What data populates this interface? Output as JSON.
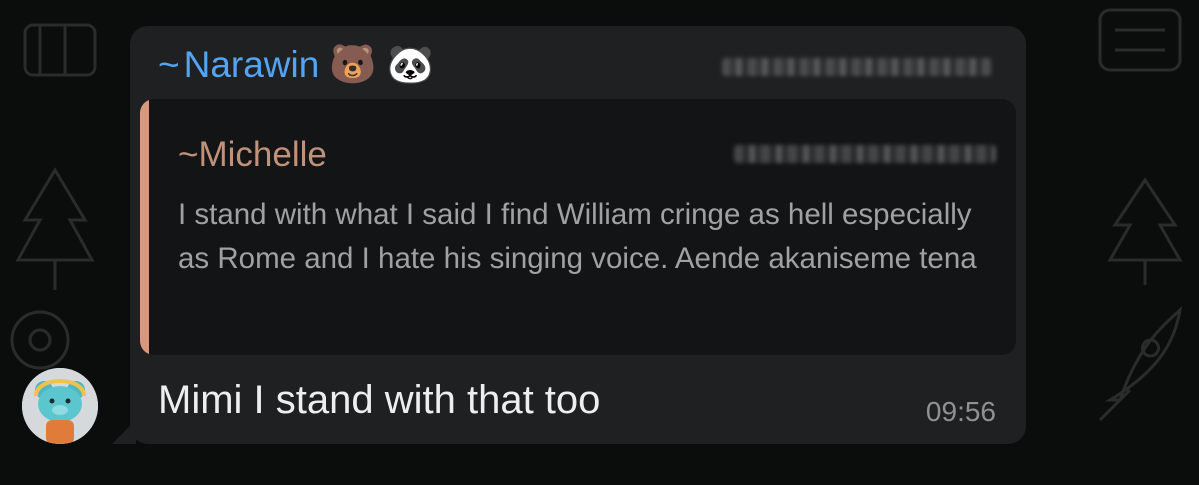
{
  "message": {
    "sender": {
      "prefix": "~",
      "name": "Narawin",
      "emojis": [
        "🐻",
        "🐼"
      ]
    },
    "quoted": {
      "prefix": "~",
      "name": "Michelle",
      "text": "I stand with what I said I find William cringe as hell especially as Rome and I hate his singing voice. Aende akaniseme tena"
    },
    "text": "Mimi I stand with that too",
    "time": "09:56"
  },
  "colors": {
    "sender_name": "#53a4f2",
    "quote_accent": "#d39a7c",
    "quote_name": "#c1917a",
    "bubble": "#1f2022",
    "background": "#0b0c0c"
  }
}
